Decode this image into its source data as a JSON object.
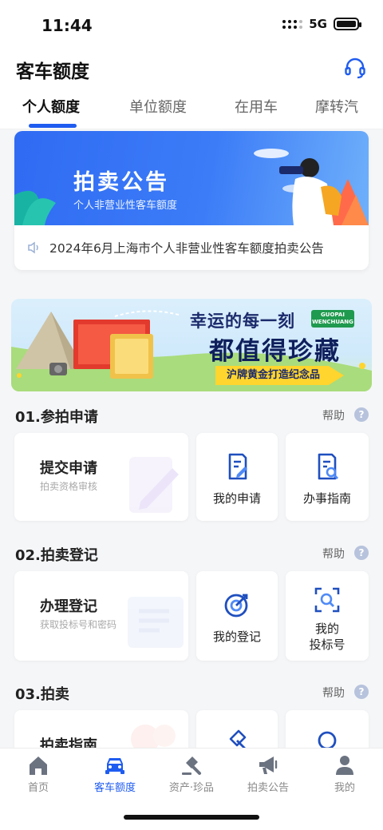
{
  "status_bar": {
    "time": "11:44",
    "network": "5G"
  },
  "header": {
    "title": "客车额度",
    "support_icon": "headset-icon"
  },
  "tabs": [
    {
      "label": "个人额度",
      "active": true
    },
    {
      "label": "单位额度",
      "active": false
    },
    {
      "label": "在用车",
      "active": false
    },
    {
      "label": "摩转汽",
      "active": false
    }
  ],
  "announcement": {
    "banner_title": "拍卖公告",
    "banner_subtitle": "个人非营业性客车额度",
    "notice_text": "2024年6月上海市个人非营业性客车额度拍卖公告",
    "notice_icon": "speaker-icon"
  },
  "promo": {
    "line1": "幸运的每一刻",
    "tag": "GUOPAI WENCHUANG",
    "line2": "都值得珍藏",
    "line3": "沪牌黄金打造纪念品"
  },
  "sections": [
    {
      "title": "01.参拍申请",
      "help": "帮助",
      "main": {
        "title": "提交申请",
        "subtitle": "拍卖资格审核"
      },
      "items": [
        {
          "label": "我的申请"
        },
        {
          "label": "办事指南"
        }
      ]
    },
    {
      "title": "02.拍卖登记",
      "help": "帮助",
      "main": {
        "title": "办理登记",
        "subtitle": "获取投标号和密码"
      },
      "items": [
        {
          "label": "我的登记"
        },
        {
          "label": "我的\n投标号",
          "line1": "我的",
          "line2": "投标号"
        }
      ]
    },
    {
      "title": "03.拍卖",
      "help": "帮助",
      "main": {
        "title": "拍卖指南",
        "subtitle": ""
      },
      "items": [
        {
          "label": ""
        },
        {
          "label": ""
        }
      ]
    }
  ],
  "tabbar": [
    {
      "label": "首页",
      "icon": "home-icon",
      "active": false
    },
    {
      "label": "客车额度",
      "icon": "car-icon",
      "active": true
    },
    {
      "label": "资产·珍品",
      "icon": "gavel-icon",
      "active": false
    },
    {
      "label": "拍卖公告",
      "icon": "megaphone-icon",
      "active": false
    },
    {
      "label": "我的",
      "icon": "person-icon",
      "active": false
    }
  ],
  "colors": {
    "accent": "#1f5cf0",
    "banner_blue": "#2f6bf3",
    "promo_yellow": "#ffd52e"
  }
}
